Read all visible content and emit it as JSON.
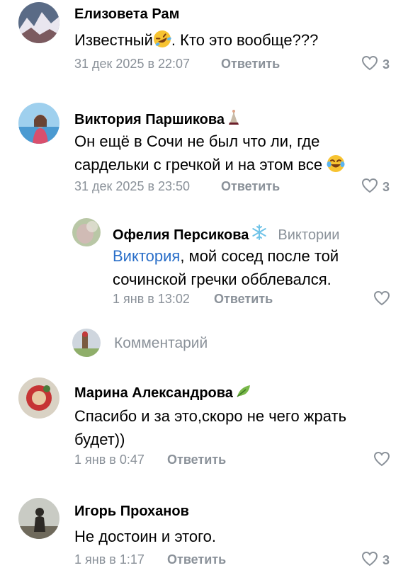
{
  "comments": [
    {
      "author": "Елизовета Рам",
      "text_a": "Известный",
      "text_b": ". Кто это вообще???",
      "date": "31 дек 2025 в 22:07",
      "reply_label": "Ответить",
      "likes": "3"
    },
    {
      "author": "Виктория Паршикова",
      "line1": "Он ещё в Сочи не был что ли, где",
      "line2": "сардельки с гречкой и на этом все",
      "date": "31 дек 2025 в 23:50",
      "reply_label": "Ответить",
      "likes": "3"
    },
    {
      "author": "Офелия Персикова",
      "reply_to": "Виктории",
      "mention": "Виктория",
      "line1_rest": ", мой сосед после той",
      "line2": "сочинской гречки обблевался.",
      "date": "1 янв в 13:02",
      "reply_label": "Ответить"
    },
    {
      "author": "Марина Александрова",
      "line1": "Спасибо и за это,скоро не чего жрать",
      "line2": "будет))",
      "date": "1 янв в 0:47",
      "reply_label": "Ответить"
    },
    {
      "author": "Игорь Проханов",
      "text": "Не достоин и этого.",
      "date": "1 янв в 1:17",
      "reply_label": "Ответить",
      "likes": "3"
    }
  ],
  "reply_field": {
    "placeholder": "Комментарий"
  },
  "icons": {
    "like": "heart-outline-icon",
    "emoji_laugh": "rolling-on-floor-laughing-emoji",
    "emoji_tears": "tears-of-joy-emoji"
  },
  "colors": {
    "meta_gray": "#8a9199",
    "mention_blue": "#2a6fc9"
  }
}
